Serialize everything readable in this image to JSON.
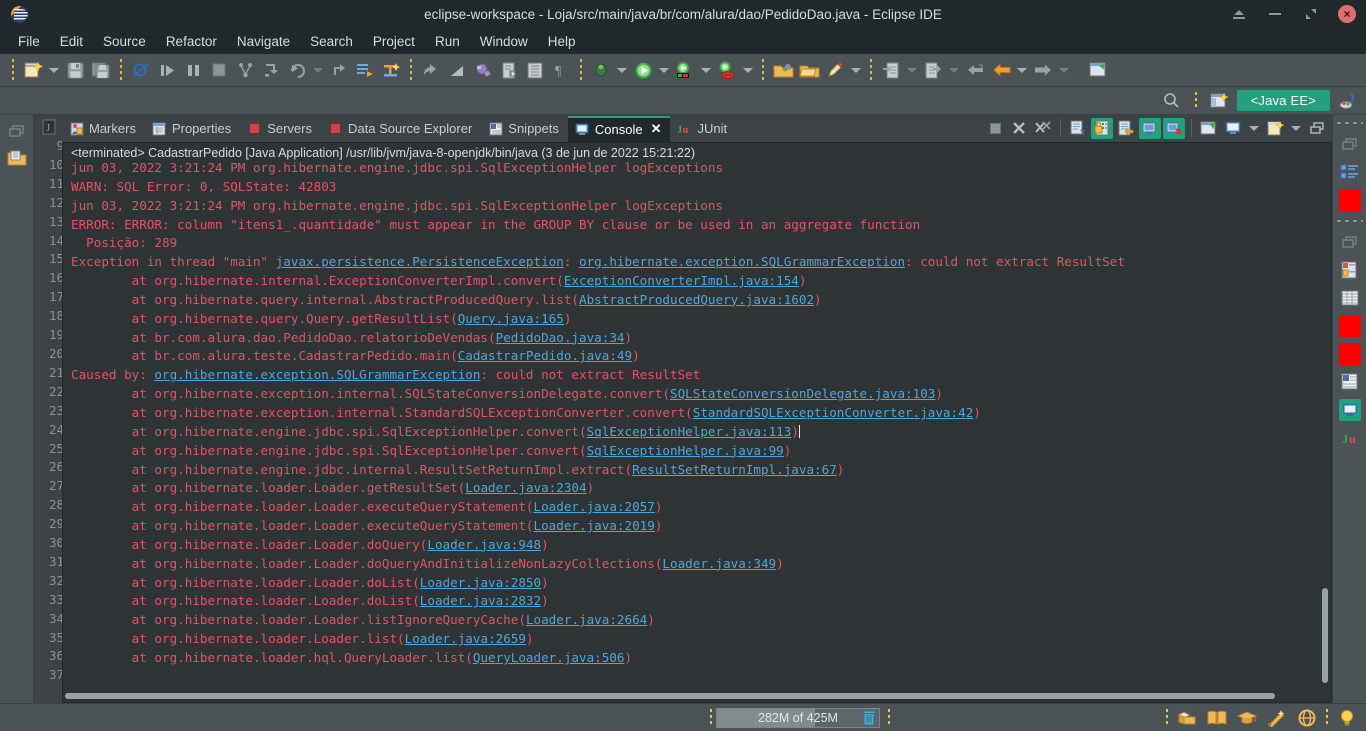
{
  "window": {
    "title": "eclipse-workspace - Loja/src/main/java/br/com/alura/dao/PedidoDao.java - Eclipse IDE",
    "controls": {
      "shade": "shade-icon",
      "minimize": "minimize-icon",
      "maximize": "maximize-icon",
      "close": "×"
    }
  },
  "menubar": {
    "items": [
      {
        "label": "File"
      },
      {
        "label": "Edit"
      },
      {
        "label": "Source"
      },
      {
        "label": "Refactor"
      },
      {
        "label": "Navigate"
      },
      {
        "label": "Search"
      },
      {
        "label": "Project"
      },
      {
        "label": "Run"
      },
      {
        "label": "Window"
      },
      {
        "label": "Help"
      }
    ]
  },
  "perspective": {
    "search_icon": "search-icon",
    "open_perspective_icon": "open-perspective-icon",
    "active_label": "<Java EE>",
    "java_perspective_icon": "java-perspective-icon"
  },
  "console_tabs": [
    {
      "label": "Markers",
      "icon": "markers-icon",
      "active": false
    },
    {
      "label": "Properties",
      "icon": "properties-icon",
      "active": false
    },
    {
      "label": "Servers",
      "icon": "servers-icon",
      "active": false
    },
    {
      "label": "Data Source Explorer",
      "icon": "data-source-icon",
      "active": false
    },
    {
      "label": "Snippets",
      "icon": "snippets-icon",
      "active": false
    },
    {
      "label": "Console",
      "icon": "console-icon",
      "active": true,
      "closable": true
    },
    {
      "label": "JUnit",
      "icon": "junit-icon",
      "active": false
    }
  ],
  "console": {
    "header": "<terminated> CadastrarPedido [Java Application] /usr/lib/jvm/java-8-openjdk/bin/java (3 de jun de 2022 15:21:22)",
    "lines": [
      {
        "segments": [
          {
            "t": "jun 03, 2022 3:21:24 PM org.hibernate.engine.jdbc.spi.SqlExceptionHelper logExceptions",
            "k": "err"
          }
        ]
      },
      {
        "segments": [
          {
            "t": "WARN: SQL Error: 0, SQLState: 42803",
            "k": "err"
          }
        ]
      },
      {
        "segments": [
          {
            "t": "jun 03, 2022 3:21:24 PM org.hibernate.engine.jdbc.spi.SqlExceptionHelper logExceptions",
            "k": "err"
          }
        ]
      },
      {
        "segments": [
          {
            "t": "ERROR: ERROR: column \"itens1_.quantidade\" must appear in the GROUP BY clause or be used in an aggregate function",
            "k": "err"
          }
        ]
      },
      {
        "segments": [
          {
            "t": "  Posição: 289",
            "k": "err"
          }
        ]
      },
      {
        "segments": [
          {
            "t": "Exception in thread \"main\" ",
            "k": "err"
          },
          {
            "t": "javax.persistence.PersistenceException",
            "k": "link"
          },
          {
            "t": ": ",
            "k": "err"
          },
          {
            "t": "org.hibernate.exception.SQLGrammarException",
            "k": "link"
          },
          {
            "t": ": could not extract ResultSet",
            "k": "err"
          }
        ]
      },
      {
        "segments": [
          {
            "t": "\tat org.hibernate.internal.ExceptionConverterImpl.convert(",
            "k": "err"
          },
          {
            "t": "ExceptionConverterImpl.java:154",
            "k": "link"
          },
          {
            "t": ")",
            "k": "err"
          }
        ]
      },
      {
        "segments": [
          {
            "t": "\tat org.hibernate.query.internal.AbstractProducedQuery.list(",
            "k": "err"
          },
          {
            "t": "AbstractProducedQuery.java:1602",
            "k": "link"
          },
          {
            "t": ")",
            "k": "err"
          }
        ]
      },
      {
        "segments": [
          {
            "t": "\tat org.hibernate.query.Query.getResultList(",
            "k": "err"
          },
          {
            "t": "Query.java:165",
            "k": "link"
          },
          {
            "t": ")",
            "k": "err"
          }
        ]
      },
      {
        "segments": [
          {
            "t": "\tat br.com.alura.dao.PedidoDao.relatorioDeVendas(",
            "k": "err"
          },
          {
            "t": "PedidoDao.java:34",
            "k": "link"
          },
          {
            "t": ")",
            "k": "err"
          }
        ]
      },
      {
        "segments": [
          {
            "t": "\tat br.com.alura.teste.CadastrarPedido.main(",
            "k": "err"
          },
          {
            "t": "CadastrarPedido.java:49",
            "k": "link"
          },
          {
            "t": ")",
            "k": "err"
          }
        ]
      },
      {
        "segments": [
          {
            "t": "Caused by: ",
            "k": "err"
          },
          {
            "t": "org.hibernate.exception.SQLGrammarException",
            "k": "link"
          },
          {
            "t": ": could not extract ResultSet",
            "k": "err"
          }
        ]
      },
      {
        "segments": [
          {
            "t": "\tat org.hibernate.exception.internal.SQLStateConversionDelegate.convert(",
            "k": "err"
          },
          {
            "t": "SQLStateConversionDelegate.java:103",
            "k": "link"
          },
          {
            "t": ")",
            "k": "err"
          }
        ]
      },
      {
        "segments": [
          {
            "t": "\tat org.hibernate.exception.internal.StandardSQLExceptionConverter.convert(",
            "k": "err"
          },
          {
            "t": "StandardSQLExceptionConverter.java:42",
            "k": "link"
          },
          {
            "t": ")",
            "k": "err"
          }
        ]
      },
      {
        "segments": [
          {
            "t": "\tat org.hibernate.engine.jdbc.spi.SqlExceptionHelper.convert(",
            "k": "err"
          },
          {
            "t": "SqlExceptionHelper.java:113",
            "k": "link"
          },
          {
            "t": ")",
            "k": "err"
          },
          {
            "t": "",
            "k": "caret"
          }
        ]
      },
      {
        "segments": [
          {
            "t": "\tat org.hibernate.engine.jdbc.spi.SqlExceptionHelper.convert(",
            "k": "err"
          },
          {
            "t": "SqlExceptionHelper.java:99",
            "k": "link"
          },
          {
            "t": ")",
            "k": "err"
          }
        ]
      },
      {
        "segments": [
          {
            "t": "\tat org.hibernate.engine.jdbc.internal.ResultSetReturnImpl.extract(",
            "k": "err"
          },
          {
            "t": "ResultSetReturnImpl.java:67",
            "k": "link"
          },
          {
            "t": ")",
            "k": "err"
          }
        ]
      },
      {
        "segments": [
          {
            "t": "\tat org.hibernate.loader.Loader.getResultSet(",
            "k": "err"
          },
          {
            "t": "Loader.java:2304",
            "k": "link"
          },
          {
            "t": ")",
            "k": "err"
          }
        ]
      },
      {
        "segments": [
          {
            "t": "\tat org.hibernate.loader.Loader.executeQueryStatement(",
            "k": "err"
          },
          {
            "t": "Loader.java:2057",
            "k": "link"
          },
          {
            "t": ")",
            "k": "err"
          }
        ]
      },
      {
        "segments": [
          {
            "t": "\tat org.hibernate.loader.Loader.executeQueryStatement(",
            "k": "err"
          },
          {
            "t": "Loader.java:2019",
            "k": "link"
          },
          {
            "t": ")",
            "k": "err"
          }
        ]
      },
      {
        "segments": [
          {
            "t": "\tat org.hibernate.loader.Loader.doQuery(",
            "k": "err"
          },
          {
            "t": "Loader.java:948",
            "k": "link"
          },
          {
            "t": ")",
            "k": "err"
          }
        ]
      },
      {
        "segments": [
          {
            "t": "\tat org.hibernate.loader.Loader.doQueryAndInitializeNonLazyCollections(",
            "k": "err"
          },
          {
            "t": "Loader.java:349",
            "k": "link"
          },
          {
            "t": ")",
            "k": "err"
          }
        ]
      },
      {
        "segments": [
          {
            "t": "\tat org.hibernate.loader.Loader.doList(",
            "k": "err"
          },
          {
            "t": "Loader.java:2850",
            "k": "link"
          },
          {
            "t": ")",
            "k": "err"
          }
        ]
      },
      {
        "segments": [
          {
            "t": "\tat org.hibernate.loader.Loader.doList(",
            "k": "err"
          },
          {
            "t": "Loader.java:2832",
            "k": "link"
          },
          {
            "t": ")",
            "k": "err"
          }
        ]
      },
      {
        "segments": [
          {
            "t": "\tat org.hibernate.loader.Loader.listIgnoreQueryCache(",
            "k": "err"
          },
          {
            "t": "Loader.java:2664",
            "k": "link"
          },
          {
            "t": ")",
            "k": "err"
          }
        ]
      },
      {
        "segments": [
          {
            "t": "\tat org.hibernate.loader.Loader.list(",
            "k": "err"
          },
          {
            "t": "Loader.java:2659",
            "k": "link"
          },
          {
            "t": ")",
            "k": "err"
          }
        ]
      },
      {
        "segments": [
          {
            "t": "\tat org.hibernate.loader.hql.QueryLoader.list(",
            "k": "err"
          },
          {
            "t": "QueryLoader.java:506",
            "k": "link"
          },
          {
            "t": ")",
            "k": "err"
          }
        ]
      }
    ]
  },
  "editor_gutter": {
    "line_numbers": [
      "9",
      "10",
      "11",
      "12",
      "13",
      "14",
      "15",
      "16",
      "17",
      "18",
      "19",
      "20",
      "21",
      "22",
      "23",
      "24",
      "25",
      "26",
      "27",
      "28",
      "29",
      "30",
      "31",
      "32",
      "33",
      "34",
      "35",
      "36",
      "37"
    ]
  },
  "statusbar": {
    "heap_label": "282M of 425M",
    "trash_icon": "trash-icon",
    "right_icons": [
      "package-icon",
      "book-icon",
      "graduation-cap-icon",
      "wand-icon",
      "globe-icon",
      "lightbulb-icon"
    ]
  },
  "colors": {
    "accent": "#23a17f",
    "error_text": "#e05561",
    "link": "#4ea7d8",
    "titlebar_bg": "#20282b",
    "toolbar_bg": "#4c5356",
    "console_bg": "#2e3436"
  }
}
